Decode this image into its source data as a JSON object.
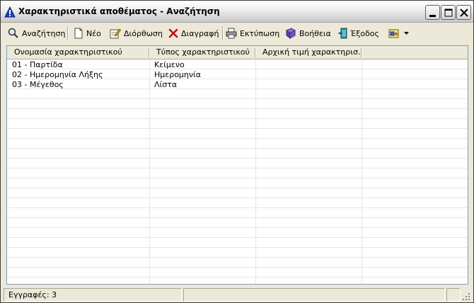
{
  "window": {
    "title": "Χαρακτηριστικά αποθέματος - Αναζήτηση"
  },
  "toolbar": {
    "search_label": "Αναζήτηση",
    "new_label": "Νέο",
    "edit_label": "Διόρθωση",
    "delete_label": "Διαγραφή",
    "print_label": "Εκτύπωση",
    "help_label": "Βοήθεια",
    "exit_label": "Έξοδος"
  },
  "grid": {
    "columns": [
      {
        "label": "Ονομασία χαρακτηριστικού"
      },
      {
        "label": "Τύπος χαρακτηριστικού"
      },
      {
        "label": "Αρχική τιμή χαρακτηρισ..."
      }
    ],
    "rows": [
      {
        "name": "01 - Παρτίδα",
        "type": "Κείμενο",
        "initial": ""
      },
      {
        "name": "02 - Ημερομηνία Λήξης",
        "type": "Ημερομηνία",
        "initial": ""
      },
      {
        "name": "03 - Μέγεθος",
        "type": "Λίστα",
        "initial": ""
      }
    ]
  },
  "status": {
    "records_label": "Εγγραφές: 3"
  },
  "colors": {
    "window_bg": "#ece9d8",
    "grid_line": "#e6e6e6",
    "app_icon_blue": "#1f3fbf"
  }
}
